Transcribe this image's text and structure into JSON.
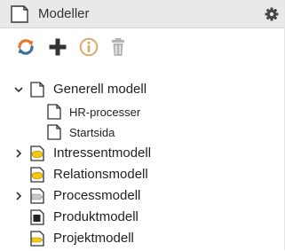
{
  "panel": {
    "title": "Modeller",
    "header_icon": "document-icon",
    "settings_icon": "gear-icon"
  },
  "toolbar": {
    "buttons": [
      {
        "name": "sync-button",
        "icon": "refresh-icon",
        "color": "#e8782a"
      },
      {
        "name": "add-button",
        "icon": "plus-icon",
        "color": "#333333"
      },
      {
        "name": "info-button",
        "icon": "info-icon",
        "color": "#e0a66a"
      },
      {
        "name": "delete-button",
        "icon": "trash-icon",
        "color": "#b5b5b5"
      }
    ]
  },
  "tree": {
    "nodes": [
      {
        "label": "Generell modell",
        "expanded": true,
        "icon": "page-icon"
      },
      {
        "label": "HR-processer",
        "icon": "page-icon"
      },
      {
        "label": "Startsida",
        "icon": "page-icon"
      },
      {
        "label": "Intressentmodell",
        "expanded": false,
        "icon": "yellow-ellipse-icon",
        "color": "#f2c811"
      },
      {
        "label": "Relationsmodell",
        "icon": "yellow-ellipse-icon",
        "color": "#f2c811"
      },
      {
        "label": "Processmodell",
        "expanded": false,
        "icon": "gray-process-icon",
        "color": "#c8c8c8"
      },
      {
        "label": "Produktmodell",
        "icon": "black-square-icon",
        "color": "#222222"
      },
      {
        "label": "Projektmodell",
        "icon": "yellow-arrow-icon",
        "color": "#f2c811"
      }
    ]
  }
}
